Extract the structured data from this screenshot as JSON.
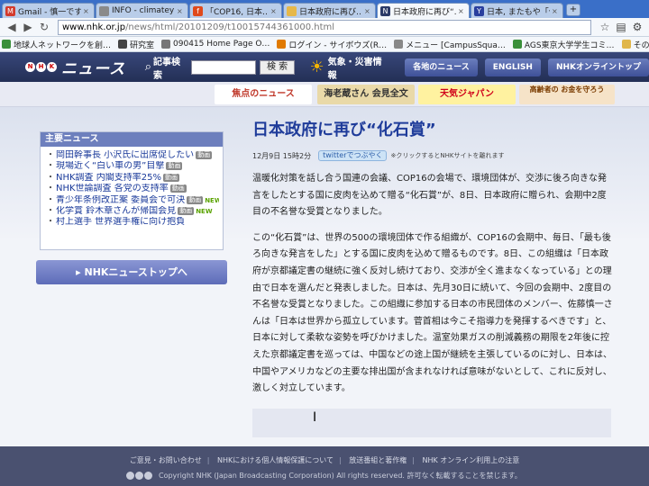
{
  "browser": {
    "tabs": [
      {
        "label": "Gmail - 慎一です…",
        "icon_color": "#d33a2c",
        "icon_text": "M",
        "active": false
      },
      {
        "label": "INFO - climatey…",
        "icon_color": "#8a8a8a",
        "icon_text": "",
        "active": false
      },
      {
        "label": "「COP16, 日本…",
        "icon_color": "#e04a1b",
        "icon_text": "f",
        "active": false
      },
      {
        "label": "日本政府に再び…",
        "icon_color": "#e6b84a",
        "icon_text": "",
        "active": false
      },
      {
        "label": "日本政府に再び“…",
        "icon_color": "#2b3a67",
        "icon_text": "N",
        "active": true
      },
      {
        "label": "日本, またもや「化…",
        "icon_color": "#2a3f9e",
        "icon_text": "Y",
        "active": false
      }
    ],
    "url_host": "www.nhk.or.jp",
    "url_path": "/news/html/20101209/t10015744361000.html",
    "bookmarks": [
      {
        "label": "地球人ネットワークを創…",
        "color": "#3a8f3a"
      },
      {
        "label": "研究室",
        "color": "#444"
      },
      {
        "label": "090415 Home Page O…",
        "color": "#777"
      },
      {
        "label": "ログイン - サイボウズ(R…",
        "color": "#e07a00"
      },
      {
        "label": "メニュー [CampusSqua…",
        "color": "#888"
      },
      {
        "label": "AGS東京大学学生コミ…",
        "color": "#3a8f3a"
      }
    ],
    "other_bookmarks": "その他のブックマーク"
  },
  "header": {
    "logo_text": "ニュース",
    "search_label": "記事検索",
    "search_button": "検 索",
    "weather_label": "気象・災害情報",
    "nav": [
      "各地のニュース",
      "ENGLISH",
      "NHKオンライントップ"
    ]
  },
  "banners": [
    {
      "label": "焦点のニュース",
      "bg": "#ffffff",
      "fg": "#c0392b"
    },
    {
      "label": "海老蔵さん 会見全文",
      "bg": "#e9d9a8",
      "fg": "#333333"
    },
    {
      "label": "天気ジャパン",
      "bg": "#fff2a0",
      "fg": "#d0021b"
    },
    {
      "label": "高齢者の お金を守ろう",
      "bg": "#f6e3c8",
      "fg": "#7a3b00"
    }
  ],
  "top_news": {
    "heading": "主要ニュース",
    "items": [
      {
        "text": "岡田幹事長 小沢氏に出席促したい",
        "tag": "動画",
        "is_new": false
      },
      {
        "text": "現場近く“白い車の男”目撃",
        "tag": "動画",
        "is_new": false
      },
      {
        "text": "NHK調査 内閣支持率25%",
        "tag": "動画",
        "is_new": false
      },
      {
        "text": "NHK世論調査 各党の支持率",
        "tag": "動画",
        "is_new": false
      },
      {
        "text": "青少年条例改正案 委員会で可決",
        "tag": "動画",
        "is_new": true
      },
      {
        "text": "化学賞 鈴木章さんが帰国会見",
        "tag": "動画",
        "is_new": true
      },
      {
        "text": "村上選手 世界選手権に向け抱負",
        "tag": "",
        "is_new": false
      }
    ],
    "new_label": "NEW"
  },
  "top_link": "NHKニューストップへ",
  "article": {
    "title": "日本政府に再び“化石賞”",
    "date": "12月9日 15時2分",
    "twitter_label": "twitterでつぶやく",
    "twitter_note": "※クリックするとNHKサイトを離れます",
    "paragraph1": "温暖化対策を話し合う国連の会議、COP16の会場で、環境団体が、交渉に後ろ向きな発言をしたとする国に皮肉を込めて贈る“化石賞”が、8日、日本政府に贈られ、会期中2度目の不名誉な受賞となりました。",
    "paragraph2": "この“化石賞”は、世界の500の環境団体で作る組織が、COP16の会期中、毎日、「最も後ろ向きな発言をした」とする国に皮肉を込めて贈るものです。8日、この組織は「日本政府が京都議定書の継続に強く反対し続けており、交渉が全く進まなくなっている」との理由で日本を選んだと発表しました。日本は、先月30日に続いて、今回の会期中、2度目の不名誉な受賞となりました。この組織に参加する日本の市民団体のメンバー、佐藤慎一さんは「日本は世界から孤立しています。菅首相は今こそ指導力を発揮するべきです」と、日本に対して柔軟な姿勢を呼びかけました。温室効果ガスの削減義務の期限を2年後に控えた京都議定書を巡っては、中国などの途上国が継続を主張しているのに対し、日本は、中国やアメリカなどの主要な排出国が含まれなければ意味がないとして、これに反対し、激しく対立しています。"
  },
  "footer": {
    "links": [
      "ご意見・お問い合わせ",
      "NHKにおける個人情報保護について",
      "放送番組と著作権",
      "NHK オンライン利用上の注意"
    ],
    "copyright": "Copyright NHK (Japan Broadcasting Corporation) All rights reserved. 許可なく転載することを禁じます。"
  }
}
